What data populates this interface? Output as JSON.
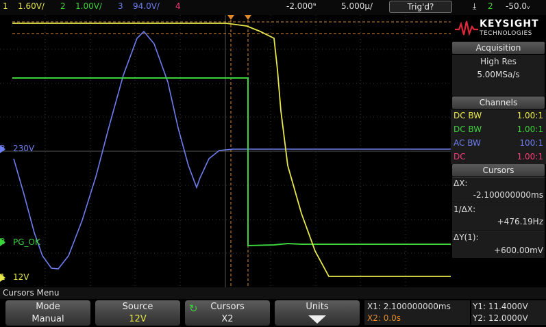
{
  "topbar": {
    "ch1": {
      "num": "1",
      "scale": "1.60V/",
      "color": "#e8e84a"
    },
    "ch2": {
      "num": "2",
      "scale": "1.00V/",
      "color": "#3cd23c"
    },
    "ch3": {
      "num": "3",
      "scale": "94.0V/",
      "color": "#6e7ef0"
    },
    "ch4": {
      "num": "4",
      "color": "#ff3a7a"
    },
    "time_delay": "-2.000⁹",
    "time_base": "5.000µ/",
    "trigger_status": "Trig'd?",
    "trigger_icon": "trigger-edge-icon",
    "trigger_source": "2",
    "trigger_level": "-50.0ᵥ"
  },
  "waveform_labels": {
    "ch3_label": "230V",
    "ch2_label": "PG_OK",
    "ch1_label": "12V",
    "ch3_marker": "3",
    "ch2_marker": "2",
    "ch1_marker": "1"
  },
  "panel": {
    "brand_main": "KEYSIGHT",
    "brand_sub": "TECHNOLOGIES",
    "acquisition_title": "Acquisition",
    "acq_mode": "High Res",
    "acq_rate": "5.00MSa/s",
    "channels_title": "Channels",
    "channels": [
      {
        "coupling": "DC BW",
        "probe": "1.00:1",
        "color": "#e8e84a"
      },
      {
        "coupling": "DC BW",
        "probe": "1.00:1",
        "color": "#3cd23c"
      },
      {
        "coupling": "AC BW",
        "probe": "100:1",
        "color": "#6e7ef0"
      },
      {
        "coupling": "DC",
        "probe": "1.00:1",
        "color": "#ff3a7a"
      }
    ],
    "cursors_title": "Cursors",
    "dx_label": "ΔX:",
    "dx_value": "-2.100000000ms",
    "inv_dx_label": "1/ΔX:",
    "inv_dx_value": "+476.19Hz",
    "dy_label": "ΔY(1):",
    "dy_value": "+600.00mV"
  },
  "menu": {
    "title": "Cursors Menu",
    "keys": [
      {
        "label": "Mode",
        "value": "Manual"
      },
      {
        "label": "Source",
        "value": "12V"
      },
      {
        "label": "Cursors",
        "value": "X2"
      },
      {
        "label": "Units",
        "value": ""
      }
    ],
    "x1": "X1: 2.100000000ms",
    "x2": "X2: 0.0s",
    "y1": "Y1: 11.4000V",
    "y2": "Y2: 12.0000V"
  }
}
